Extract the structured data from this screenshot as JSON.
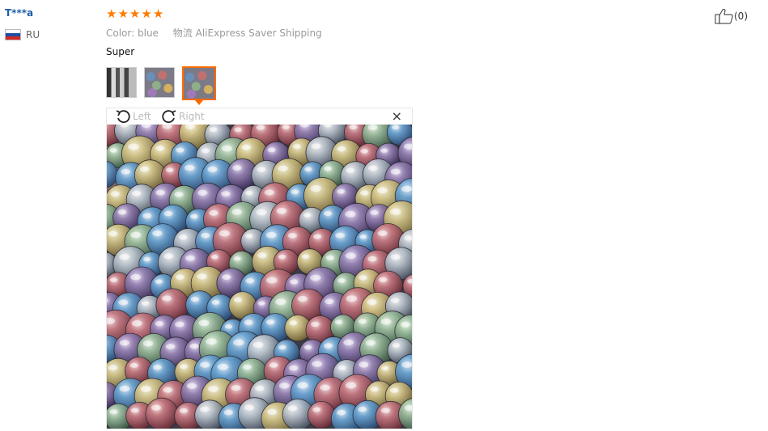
{
  "reviewer": {
    "name": "T***a",
    "country": "RU"
  },
  "rating": {
    "value": 5,
    "max": 5,
    "star_glyph": "★",
    "color": "#ff7a00"
  },
  "meta": {
    "color_label": "Color:",
    "color_value": "blue",
    "logistics_label": "物流",
    "logistics_value": "AliExpress Saver Shipping"
  },
  "review": {
    "text": "Super"
  },
  "thumbnails": {
    "count": 3,
    "active_index": 2
  },
  "viewer": {
    "rotate_left_label": "Left",
    "rotate_right_label": "Right",
    "close_label": "×"
  },
  "helpful": {
    "count_label": "(0)"
  },
  "colors": {
    "accent": "#ff6a00",
    "username": "#1f5fa8"
  }
}
